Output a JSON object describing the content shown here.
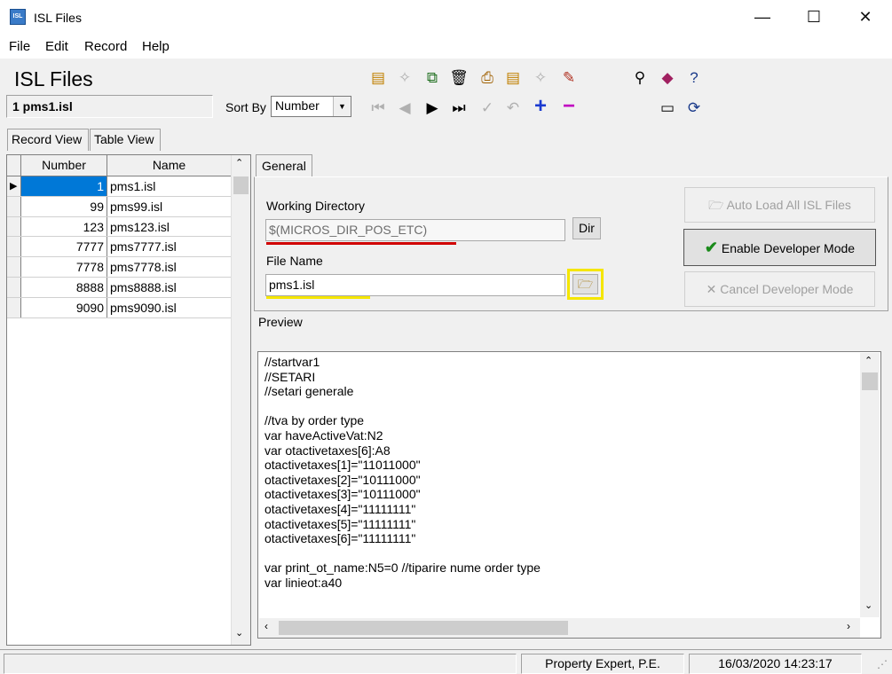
{
  "window": {
    "title": "ISL Files",
    "minimize": "—",
    "maximize": "☐",
    "close": "✕"
  },
  "menu": {
    "file": "File",
    "edit": "Edit",
    "record": "Record",
    "help": "Help"
  },
  "header": {
    "title": "ISL Files",
    "record_indicator": "1 pms1.isl",
    "sort_label": "Sort By",
    "sort_value": "Number"
  },
  "tabs": {
    "record_view": "Record View",
    "table_view": "Table View",
    "general": "General"
  },
  "grid": {
    "columns": [
      "Number",
      "Name"
    ],
    "rows": [
      {
        "number": "1",
        "name": "pms1.isl"
      },
      {
        "number": "99",
        "name": "pms99.isl"
      },
      {
        "number": "123",
        "name": "pms123.isl"
      },
      {
        "number": "7777",
        "name": "pms7777.isl"
      },
      {
        "number": "7778",
        "name": "pms7778.isl"
      },
      {
        "number": "8888",
        "name": "pms8888.isl"
      },
      {
        "number": "9090",
        "name": "pms9090.isl"
      }
    ]
  },
  "form": {
    "working_dir_label": "Working Directory",
    "working_dir_value": "$(MICROS_DIR_POS_ETC)",
    "dir_button": "Dir",
    "file_name_label": "File Name",
    "file_name_value": "pms1.isl",
    "auto_load_button": "Auto Load All ISL Files",
    "enable_dev_button": "Enable Developer Mode",
    "cancel_dev_button": "Cancel Developer Mode"
  },
  "preview": {
    "label": "Preview",
    "text": "//startvar1\n//SETARI\n//setari generale\n\n//tva by order type\nvar haveActiveVat:N2\nvar otactivetaxes[6]:A8\notactivetaxes[1]=\"11011000\"\notactivetaxes[2]=\"10111000\"\notactivetaxes[3]=\"10111000\"\notactivetaxes[4]=\"11111111\"\notactivetaxes[5]=\"11111111\"\notactivetaxes[6]=\"11111111\"\n\nvar print_ot_name:N5=0 //tiparire nume order type\nvar linieot:a40"
  },
  "status": {
    "property": "Property Expert, P.E.",
    "datetime": "16/03/2020 14:23:17"
  },
  "colors": {
    "highlight_yellow": "#f5e600",
    "underline_red": "#d00000",
    "selection_blue": "#0078d7"
  }
}
